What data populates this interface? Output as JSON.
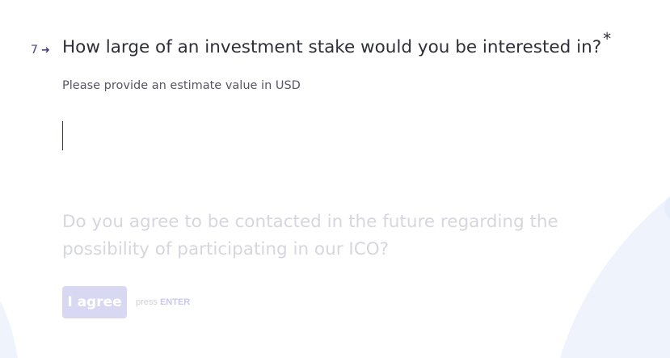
{
  "question7": {
    "number": "7",
    "title": "How large of an investment stake would you be interested in?",
    "required_mark": "*",
    "description": "Please provide an estimate value in USD",
    "answer_value": "",
    "answer_placeholder": ""
  },
  "question8": {
    "title": "Do you agree to be contacted in the future regarding the possibility of participating in our ICO?",
    "agree_label": "I agree",
    "press_text": "press",
    "press_key": "ENTER"
  },
  "icons": {
    "question_arrow": "arrow-right-icon"
  },
  "colors": {
    "accent": "#4a3f8f",
    "background_shape": "#eef3fc",
    "agree_button": "#d9d8f3"
  }
}
